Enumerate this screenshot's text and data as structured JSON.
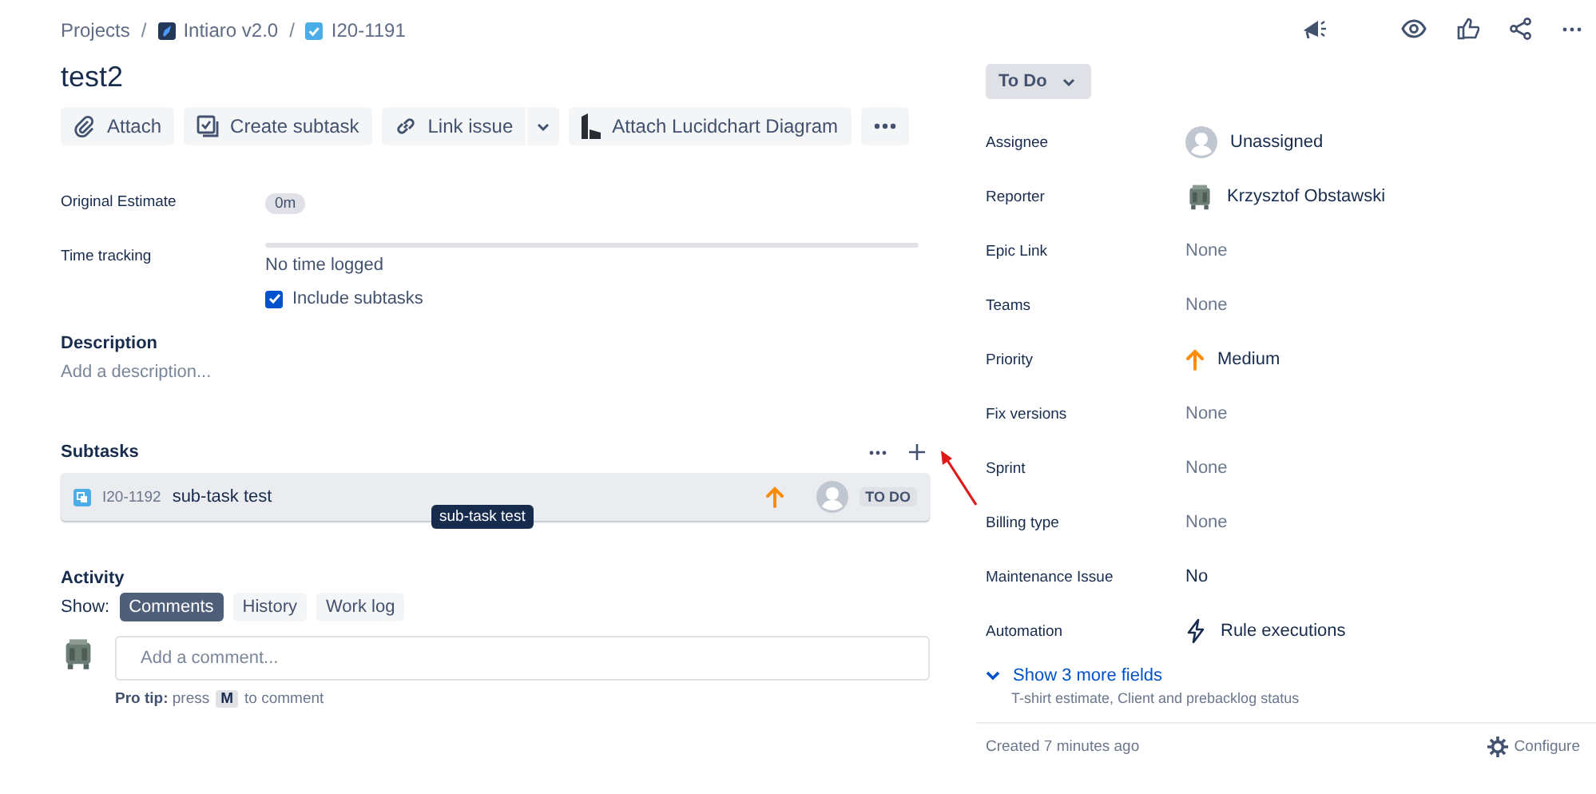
{
  "breadcrumb_separator": "/",
  "breadcrumbs": [
    {
      "kind": "text",
      "label": "Projects"
    },
    {
      "kind": "project",
      "label": "Intiaro v2.0"
    },
    {
      "kind": "issue",
      "label": "I20-1191"
    }
  ],
  "title": "test2",
  "actions": [
    {
      "kind": "attach",
      "label": "Attach"
    },
    {
      "kind": "subtask",
      "label": "Create subtask"
    },
    {
      "kind": "link",
      "label": "Link issue"
    },
    {
      "kind": "lucid",
      "label": "Attach Lucidchart Diagram"
    },
    {
      "kind": "more"
    }
  ],
  "original_estimate": {
    "label": "Original Estimate",
    "value": "0m"
  },
  "time_tracking": {
    "label": "Time tracking",
    "level": 0,
    "value": "No time logged",
    "include_subtasks": {
      "label": "Include subtasks",
      "checked": true
    }
  },
  "description": {
    "heading": "Description",
    "placeholder": "Add a description..."
  },
  "subtasks": {
    "heading": "Subtasks",
    "items": [
      {
        "key": "I20-1192",
        "summary": "sub-task test",
        "status": "TO DO"
      }
    ],
    "tooltip": "sub-task test"
  },
  "activity": {
    "heading": "Activity",
    "show_label": "Show:",
    "tabs": [
      {
        "label": "Comments",
        "selected": true
      },
      {
        "label": "History",
        "selected": false
      },
      {
        "label": "Work log",
        "selected": false
      }
    ],
    "comment_placeholder": "Add a comment...",
    "tip": {
      "prefix": "**Pro tip:** press",
      "key": "M",
      "suffix": "to comment"
    }
  },
  "status_button": "To Do",
  "fields": [
    {
      "label": "Assignee",
      "kind": "avatar",
      "value": "Unassigned"
    },
    {
      "label": "Reporter",
      "kind": "user",
      "value": "Krzysztof Obstawski"
    },
    {
      "label": "Epic Link",
      "kind": "none",
      "value": "None"
    },
    {
      "label": "Teams",
      "kind": "none",
      "value": "None"
    },
    {
      "label": "Priority",
      "kind": "priority",
      "value": "Medium"
    },
    {
      "label": "Fix versions",
      "kind": "none",
      "value": "None"
    },
    {
      "label": "Sprint",
      "kind": "none",
      "value": "None"
    },
    {
      "label": "Billing type",
      "kind": "none",
      "value": "None"
    },
    {
      "label": "Maintenance Issue",
      "kind": "plain",
      "value": "No"
    },
    {
      "label": "Automation",
      "kind": "automation",
      "value": "Rule executions"
    }
  ],
  "more_fields": {
    "label": "Show 3 more fields",
    "hint": "T-shirt estimate, Client and prebacklog status"
  },
  "footer": {
    "created": "Created 7 minutes ago",
    "configure": "Configure"
  }
}
